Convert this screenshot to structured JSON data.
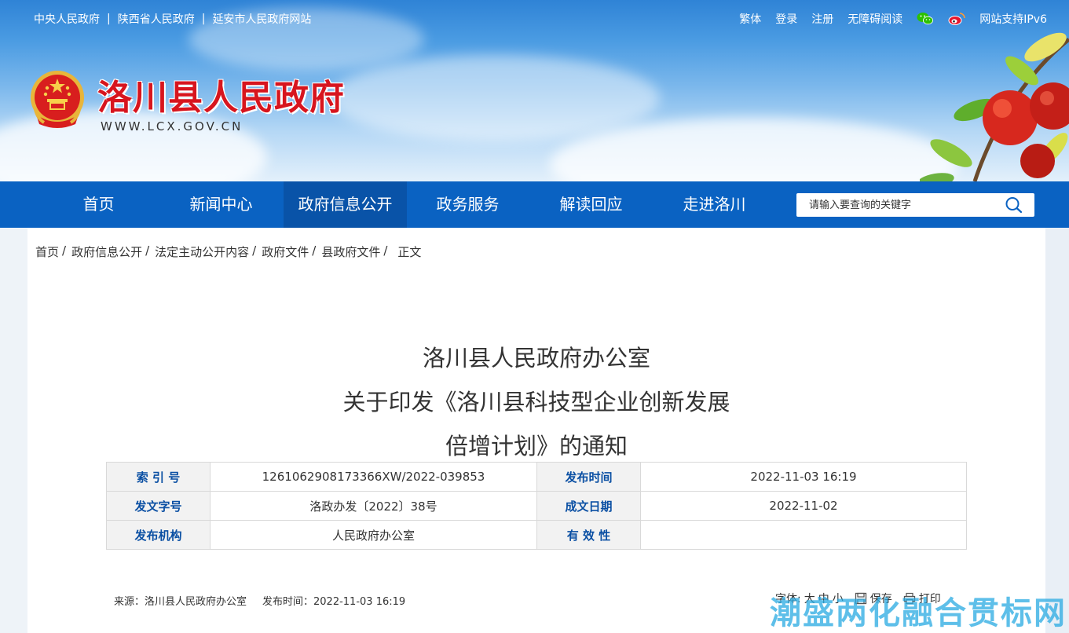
{
  "topbar": {
    "links": [
      "中央人民政府",
      "陕西省人民政府",
      "延安市人民政府网站"
    ],
    "right": {
      "simplified": "繁体",
      "login": "登录",
      "register": "注册",
      "accessible": "无障碍阅读",
      "ipv6": "网站支持IPv6"
    }
  },
  "site": {
    "title": "洛川县人民政府",
    "url": "WWW.LCX.GOV.CN"
  },
  "nav": {
    "items": [
      "首页",
      "新闻中心",
      "政府信息公开",
      "政务服务",
      "解读回应",
      "走进洛川"
    ],
    "active_index": 2,
    "search_placeholder": "请输入要查询的关键字"
  },
  "breadcrumb": [
    "首页",
    "政府信息公开",
    "法定主动公开内容",
    "政府文件",
    "县政府文件",
    "正文"
  ],
  "article": {
    "title_lines": [
      "洛川县人民政府办公室",
      "关于印发《洛川县科技型企业创新发展",
      "倍增计划》的通知"
    ]
  },
  "meta": {
    "rows": [
      {
        "label1": "索 引 号",
        "value1": "1261062908173366XW/2022-039853",
        "label2": "发布时间",
        "value2": "2022-11-03 16:19"
      },
      {
        "label1": "发文字号",
        "value1": "洛政办发〔2022〕38号",
        "label2": "成文日期",
        "value2": "2022-11-02"
      },
      {
        "label1": "发布机构",
        "value1": "人民政府办公室",
        "label2": "有 效 性",
        "value2": ""
      }
    ]
  },
  "info": {
    "source": "来源：洛川县人民政府办公室",
    "publish_time": "发布时间：2022-11-03 16:19"
  },
  "tools": {
    "font_label": "字体:",
    "sizes": [
      "大",
      "中",
      "小"
    ],
    "save": "保存",
    "print": "打印"
  },
  "watermark": "潮盛两化融合贯标网",
  "colors": {
    "nav_bg": "#0a62c2",
    "nav_active": "#0953a8",
    "title_red": "#d7151e",
    "label_blue": "#0a4fa3"
  }
}
